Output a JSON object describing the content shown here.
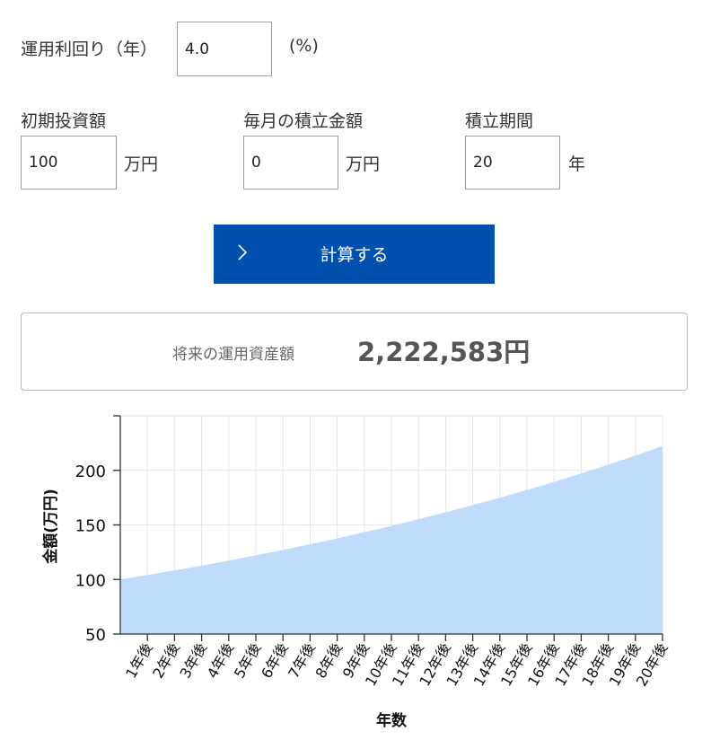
{
  "form": {
    "rate_label": "運用利回り（年）",
    "rate_value": "4.0",
    "rate_unit": "(%)",
    "initial_label": "初期投資額",
    "initial_value": "100",
    "initial_unit": "万円",
    "monthly_label": "毎月の積立金額",
    "monthly_value": "0",
    "monthly_unit": "万円",
    "period_label": "積立期間",
    "period_value": "20",
    "period_unit": "年"
  },
  "button": {
    "label": "計算する",
    "icon": "chevron-right-icon"
  },
  "result": {
    "label": "将来の運用資産額",
    "value": "2,222,583円"
  },
  "chart_data": {
    "type": "area",
    "xlabel": "年数",
    "ylabel": "金額(万円)",
    "categories": [
      "1年後",
      "2年後",
      "3年後",
      "4年後",
      "5年後",
      "6年後",
      "7年後",
      "8年後",
      "9年後",
      "10年後",
      "11年後",
      "12年後",
      "13年後",
      "14年後",
      "15年後",
      "16年後",
      "17年後",
      "18年後",
      "19年後",
      "20年後"
    ],
    "x_start": 0,
    "values": [
      100.0,
      104.1,
      108.3,
      112.7,
      117.3,
      122.1,
      127.1,
      132.3,
      137.7,
      143.3,
      149.1,
      155.2,
      161.5,
      168.1,
      174.9,
      182.0,
      189.4,
      197.2,
      205.2,
      213.5,
      222.3
    ],
    "yticks": [
      50,
      100,
      150,
      200
    ],
    "ylim": [
      50,
      250
    ],
    "grid": true,
    "fill_color": "#bfdcfc",
    "grid_color": "#e6e6e6",
    "axis_color": "#333333"
  },
  "colors": {
    "accent": "#0050ae",
    "text": "#333333"
  }
}
